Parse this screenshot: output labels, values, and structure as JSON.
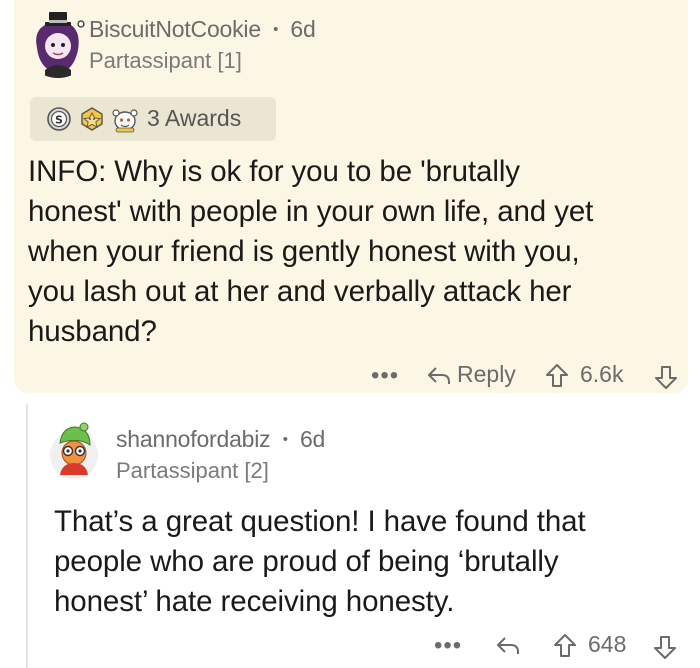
{
  "top_comment": {
    "username": "BiscuitNotCookie",
    "separator": "•",
    "age": "6d",
    "flair": "Partassipant [1]",
    "awards_label": "3 Awards",
    "body_lines": [
      "INFO: Why is ok for you to be 'brutally",
      "honest' with people in your own life, and yet",
      "when your friend is gently honest with you,",
      "you lash out at her and verbally attack her",
      "husband?"
    ],
    "more_label": "•••",
    "reply_label": "Reply",
    "score": "6.6k"
  },
  "reply_comment": {
    "username": "shannofordabiz",
    "separator": "•",
    "age": "6d",
    "flair": "Partassipant [2]",
    "body_lines": [
      "That’s a great question! I have found that",
      "people who are proud of being ‘brutally",
      "honest’ hate receiving honesty."
    ],
    "more_label": "•••",
    "score": "648"
  },
  "colors": {
    "highlight_bg": "#fcf7e4",
    "awards_bg": "#ebe6d2",
    "text": "#1a1a1a",
    "meta": "#6b6b6b"
  }
}
